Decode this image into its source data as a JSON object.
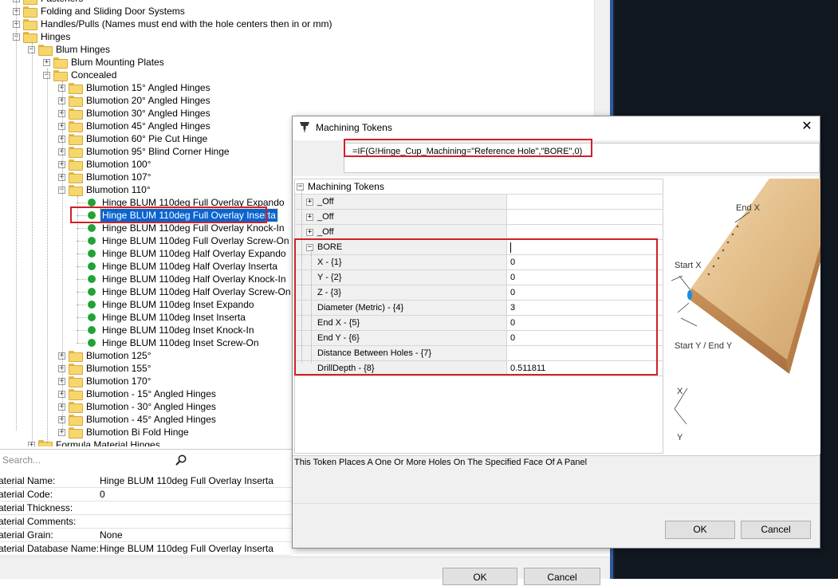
{
  "tree": {
    "nodes": [
      {
        "label": "Fasteners",
        "type": "folder",
        "indent": 0,
        "expander": "+"
      },
      {
        "label": "Folding and Sliding Door Systems",
        "type": "folder",
        "indent": 0,
        "expander": "+"
      },
      {
        "label": "Handles/Pulls (Names must end with the hole centers then in or mm)",
        "type": "folder",
        "indent": 0,
        "expander": "+"
      },
      {
        "label": "Hinges",
        "type": "folder",
        "indent": 0,
        "expander": "−"
      },
      {
        "label": "Blum Hinges",
        "type": "folder",
        "indent": 1,
        "expander": "−"
      },
      {
        "label": "Blum Mounting Plates",
        "type": "folder",
        "indent": 2,
        "expander": "+"
      },
      {
        "label": "Concealed",
        "type": "folder",
        "indent": 2,
        "expander": "−"
      },
      {
        "label": "Blumotion 15° Angled Hinges",
        "type": "folder",
        "indent": 3,
        "expander": "+"
      },
      {
        "label": "Blumotion 20° Angled Hinges",
        "type": "folder",
        "indent": 3,
        "expander": "+"
      },
      {
        "label": "Blumotion 30° Angled Hinges",
        "type": "folder",
        "indent": 3,
        "expander": "+"
      },
      {
        "label": "Blumotion 45° Angled Hinges",
        "type": "folder",
        "indent": 3,
        "expander": "+"
      },
      {
        "label": "Blumotion 60° Pie Cut Hinge",
        "type": "folder",
        "indent": 3,
        "expander": "+"
      },
      {
        "label": "Blumotion 95° Blind Corner Hinge",
        "type": "folder",
        "indent": 3,
        "expander": "+"
      },
      {
        "label": "Blumotion 100°",
        "type": "folder",
        "indent": 3,
        "expander": "+"
      },
      {
        "label": "Blumotion 107°",
        "type": "folder",
        "indent": 3,
        "expander": "+"
      },
      {
        "label": "Blumotion 110°",
        "type": "folder",
        "indent": 3,
        "expander": "−"
      },
      {
        "label": "Hinge BLUM 110deg Full Overlay Expando",
        "type": "item",
        "indent": 4
      },
      {
        "label": "Hinge BLUM 110deg Full Overlay Inserta",
        "type": "item",
        "indent": 4,
        "selected": true
      },
      {
        "label": "Hinge BLUM 110deg Full Overlay Knock-In",
        "type": "item",
        "indent": 4
      },
      {
        "label": "Hinge BLUM 110deg Full Overlay Screw-On",
        "type": "item",
        "indent": 4
      },
      {
        "label": "Hinge BLUM 110deg Half Overlay Expando",
        "type": "item",
        "indent": 4
      },
      {
        "label": "Hinge BLUM 110deg Half Overlay Inserta",
        "type": "item",
        "indent": 4
      },
      {
        "label": "Hinge BLUM 110deg Half Overlay Knock-In",
        "type": "item",
        "indent": 4
      },
      {
        "label": "Hinge BLUM 110deg Half Overlay Screw-On",
        "type": "item",
        "indent": 4
      },
      {
        "label": "Hinge BLUM 110deg Inset Expando",
        "type": "item",
        "indent": 4
      },
      {
        "label": "Hinge BLUM 110deg Inset Inserta",
        "type": "item",
        "indent": 4
      },
      {
        "label": "Hinge BLUM 110deg Inset Knock-In",
        "type": "item",
        "indent": 4
      },
      {
        "label": "Hinge BLUM 110deg Inset Screw-On",
        "type": "item",
        "indent": 4
      },
      {
        "label": "Blumotion 125°",
        "type": "folder",
        "indent": 3,
        "expander": "+"
      },
      {
        "label": "Blumotion 155°",
        "type": "folder",
        "indent": 3,
        "expander": "+"
      },
      {
        "label": "Blumotion 170°",
        "type": "folder",
        "indent": 3,
        "expander": "+"
      },
      {
        "label": "Blumotion - 15° Angled Hinges",
        "type": "folder",
        "indent": 3,
        "expander": "+"
      },
      {
        "label": "Blumotion - 30° Angled Hinges",
        "type": "folder",
        "indent": 3,
        "expander": "+"
      },
      {
        "label": "Blumotion - 45° Angled Hinges",
        "type": "folder",
        "indent": 3,
        "expander": "+"
      },
      {
        "label": "Blumotion  Bi Fold Hinge",
        "type": "folder",
        "indent": 3,
        "expander": "+"
      },
      {
        "label": "Formula Material Hinges",
        "type": "folder",
        "indent": 1,
        "expander": "+"
      }
    ]
  },
  "search": {
    "placeholder": "Search..."
  },
  "properties": [
    {
      "key": "aterial Name:",
      "value": "Hinge BLUM 110deg Full Overlay Inserta"
    },
    {
      "key": "aterial Code:",
      "value": "0"
    },
    {
      "key": "aterial Thickness:",
      "value": ""
    },
    {
      "key": "aterial Comments:",
      "value": ""
    },
    {
      "key": "aterial Grain:",
      "value": "None"
    },
    {
      "key": "aterial Database Name:",
      "value": "Hinge BLUM 110deg Full Overlay Inserta"
    }
  ],
  "main_buttons": {
    "ok": "OK",
    "cancel": "Cancel"
  },
  "dialog": {
    "title": "Machining Tokens",
    "close": "✕",
    "formula": "=IF(G!Hinge_Cup_Machining=\"Reference Hole\",\"BORE\",0)",
    "grid": {
      "root": "Machining Tokens",
      "rows": [
        {
          "name": "_Off",
          "value": "",
          "kind": "collapsed"
        },
        {
          "name": "_Off",
          "value": "",
          "kind": "collapsed"
        },
        {
          "name": "_Off",
          "value": "",
          "kind": "collapsed"
        },
        {
          "name": "BORE",
          "value": "",
          "kind": "expanded"
        },
        {
          "name": "X - {1}",
          "value": "0",
          "kind": "param"
        },
        {
          "name": "Y - {2}",
          "value": "0",
          "kind": "param"
        },
        {
          "name": "Z - {3}",
          "value": "0",
          "kind": "param"
        },
        {
          "name": "Diameter (Metric) - {4}",
          "value": "3",
          "kind": "param"
        },
        {
          "name": "End X - {5}",
          "value": "0",
          "kind": "param"
        },
        {
          "name": "End Y - {6}",
          "value": "0",
          "kind": "param"
        },
        {
          "name": "Distance Between Holes - {7}",
          "value": "",
          "kind": "param"
        },
        {
          "name": "DrillDepth - {8}",
          "value": "0.511811",
          "kind": "param"
        }
      ]
    },
    "preview_labels": {
      "end_x": "End X",
      "start_x": "Start X",
      "start_end_y": "Start Y / End Y",
      "axis_x": "X",
      "axis_y": "Y"
    },
    "description": "This Token Places A One Or More Holes On The Specified Face Of A Panel",
    "ok": "OK",
    "cancel": "Cancel"
  },
  "colors": {
    "selection": "#0a64d0",
    "highlight_box": "#d0202a",
    "item_dot": "#21a336",
    "folder": "#f5d76e"
  }
}
